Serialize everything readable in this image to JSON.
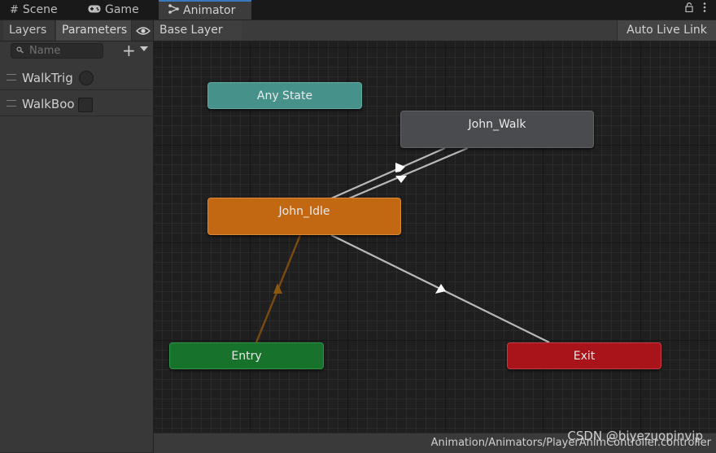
{
  "tabs": {
    "scene": {
      "label": "Scene",
      "icon": "grid-icon"
    },
    "game": {
      "label": "Game",
      "icon": "gamepad-icon"
    },
    "animator": {
      "label": "Animator",
      "icon": "animator-icon"
    }
  },
  "window_tools": {
    "lock": "lock-icon",
    "menu": "kebab-icon"
  },
  "left_panel": {
    "tabs": {
      "layers": "Layers",
      "parameters": "Parameters"
    },
    "search": {
      "placeholder": "Name",
      "value": ""
    },
    "parameters": [
      {
        "name": "WalkTrig",
        "type": "trigger"
      },
      {
        "name": "WalkBoo",
        "type": "bool",
        "value": false
      }
    ]
  },
  "graph": {
    "breadcrumb": "Base Layer",
    "live_link_label": "Auto Live Link",
    "states": {
      "any_state": {
        "label": "Any State",
        "color": "#46918a"
      },
      "john_walk": {
        "label": "John_Walk",
        "color": "#4a4b4f"
      },
      "john_idle": {
        "label": "John_Idle",
        "color": "#c26813",
        "default": true
      },
      "entry": {
        "label": "Entry",
        "color": "#17722b"
      },
      "exit": {
        "label": "Exit",
        "color": "#a8141a"
      }
    },
    "transitions": [
      {
        "from": "John_Idle",
        "to": "John_Walk"
      },
      {
        "from": "John_Walk",
        "to": "John_Idle"
      },
      {
        "from": "John_Idle",
        "to": "Exit"
      },
      {
        "from": "Entry",
        "to": "John_Idle",
        "default": true
      }
    ]
  },
  "status": {
    "path": "Animation/Animators/PlayerAnimController.controller"
  },
  "watermark": "CSDN @biyezuopinvip"
}
